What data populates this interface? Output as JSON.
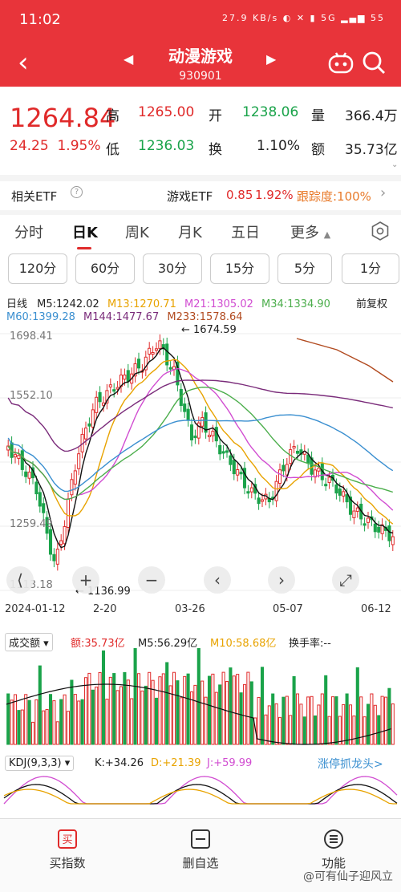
{
  "status": {
    "time": "11:02",
    "net_speed": "27.9 KB/s",
    "battery": "55",
    "signal": "5G"
  },
  "header": {
    "title": "动漫游戏",
    "code": "930901",
    "back": "‹"
  },
  "quote": {
    "price": "1264.84",
    "change": "24.25",
    "change_pct": "1.95%",
    "high_label": "高",
    "high": "1265.00",
    "low_label": "低",
    "low": "1236.03",
    "open_label": "开",
    "open": "1238.06",
    "turnover_label": "换",
    "turnover": "1.10%",
    "volume_label": "量",
    "volume": "366.4万",
    "amount_label": "额",
    "amount": "35.73亿"
  },
  "etf": {
    "label": "相关ETF",
    "name": "游戏ETF",
    "price": "0.85",
    "pct": "1.92%",
    "track": "跟踪度:100%"
  },
  "tabs": [
    "分时",
    "日K",
    "周K",
    "月K",
    "五日",
    "更多"
  ],
  "periods": [
    "120分",
    "60分",
    "30分",
    "15分",
    "5分",
    "1分"
  ],
  "ma_row1": {
    "label": "日线",
    "m5": "M5:1242.02",
    "m13": "M13:1270.71",
    "m21": "M21:1305.02",
    "m34": "M34:1334.90",
    "adj": "前复权"
  },
  "ma_row2": {
    "m60": "M60:1399.28",
    "m144": "M144:1477.67",
    "m233": "M233:1578.64"
  },
  "axis_prices": {
    "p1": "1698.41",
    "p2": "1552.10",
    "p3": "1259.49",
    "p4": "1113.18",
    "max_mark": "1674.59",
    "min_mark": "1136.99"
  },
  "axis_dates": {
    "d1": "2024-01-12",
    "d2": "2-20",
    "d3": "03-26",
    "d4": "05-07",
    "d5": "06-12"
  },
  "chips": [
    "+",
    "−",
    "‹",
    "›",
    "⤢"
  ],
  "volume": {
    "label": "成交额",
    "amt": "额:35.73亿",
    "m5": "M5:56.29亿",
    "m10": "M10:58.68亿",
    "turnover": "换手率:--"
  },
  "kdj": {
    "label": "KDJ(9,3,3)",
    "k": "K:+34.26",
    "d": "D:+21.39",
    "j": "J:+59.99",
    "link": "涨停抓龙头>"
  },
  "bottom": {
    "buy": "买指数",
    "remove": "删自选",
    "func": "功能"
  },
  "watermark": "@可有仙子迎风立",
  "colors": {
    "header": "#e8343a",
    "up": "#e02a2a",
    "down": "#1aa34a",
    "m5": "#111111",
    "m13": "#e8a300",
    "m21": "#d14dd1",
    "m34": "#4cae4c",
    "m60": "#3a8fd0",
    "m144": "#7a2b7a",
    "m233": "#b14a1f"
  }
}
